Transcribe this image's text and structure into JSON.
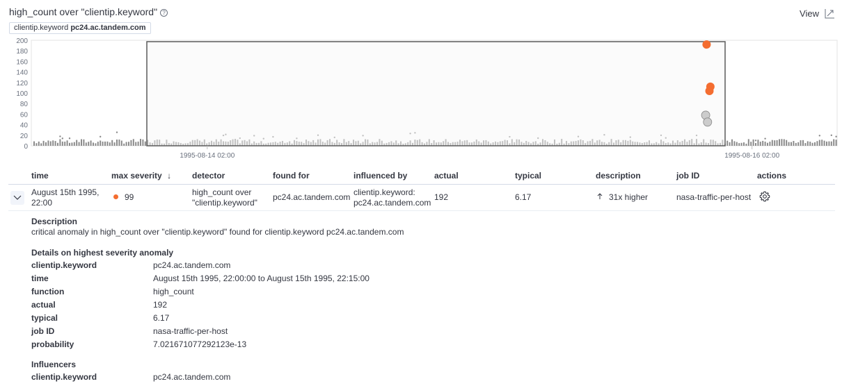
{
  "header": {
    "title": "high_count over \"clientip.keyword\"",
    "help_glyph": "?",
    "view_label": "View",
    "entity_field": "clientip.keyword",
    "entity_value": "pc24.ac.tandem.com"
  },
  "chart_data": {
    "type": "scatter",
    "y_ticks": [
      "200",
      "180",
      "160",
      "140",
      "120",
      "100",
      "80",
      "60",
      "40",
      "20",
      "0"
    ],
    "ylim": [
      0,
      200
    ],
    "x_labels": [
      "1995-08-14 02:00",
      "1995-08-16 02:00"
    ],
    "series": [
      {
        "kind": "anomalies",
        "points": [
          {
            "x": "1995-08-15 22:00",
            "y": 192,
            "severity": "critical"
          },
          {
            "x": "1995-08-15 22:20",
            "y": 112,
            "severity": "critical"
          },
          {
            "x": "1995-08-15 22:15",
            "y": 104,
            "severity": "critical"
          },
          {
            "x": "1995-08-15 21:55",
            "y": 58,
            "severity": "low"
          },
          {
            "x": "1995-08-15 22:05",
            "y": 45,
            "severity": "low"
          }
        ]
      }
    ],
    "colors": {
      "critical": "#f46d30",
      "low": "#cccccc",
      "baseline": "#8a8a8a",
      "selection": "#5a5a5a"
    }
  },
  "table": {
    "columns": [
      "time",
      "max severity",
      "detector",
      "found for",
      "influenced by",
      "actual",
      "typical",
      "description",
      "job ID",
      "actions"
    ],
    "sort_arrow": "↓",
    "row": {
      "time_line1": "August 15th 1995,",
      "time_line2": "22:00",
      "severity": "99",
      "detector_line1": "high_count over",
      "detector_line2": "\"clientip.keyword\"",
      "found_for": "pc24.ac.tandem.com",
      "influenced_line1": "clientip.keyword:",
      "influenced_line2": "pc24.ac.tandem.com",
      "actual": "192",
      "typical": "6.17",
      "description": "31x higher",
      "job_id": "nasa-traffic-per-host"
    }
  },
  "details": {
    "description_heading": "Description",
    "description_text": "critical anomaly in high_count over \"clientip.keyword\" found for clientip.keyword pc24.ac.tandem.com",
    "highest_heading": "Details on highest severity anomaly",
    "fields": [
      {
        "key": "clientip.keyword",
        "value": "pc24.ac.tandem.com"
      },
      {
        "key": "time",
        "value": "August 15th 1995, 22:00:00 to August 15th 1995, 22:15:00"
      },
      {
        "key": "function",
        "value": "high_count"
      },
      {
        "key": "actual",
        "value": "192"
      },
      {
        "key": "typical",
        "value": "6.17"
      },
      {
        "key": "job ID",
        "value": "nasa-traffic-per-host"
      },
      {
        "key": "probability",
        "value": "7.021671077292123e-13"
      }
    ],
    "influencers_heading": "Influencers",
    "influencers": [
      {
        "key": "clientip.keyword",
        "value": "pc24.ac.tandem.com"
      }
    ]
  },
  "icons": {
    "help": "help-icon",
    "view": "external-chart-icon",
    "expand": "chevron-down-icon",
    "arrow": "arrow-up-icon",
    "actions": "gear-icon"
  }
}
